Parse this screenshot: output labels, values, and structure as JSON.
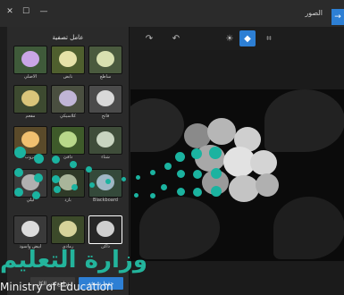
{
  "window": {
    "title": "الصور",
    "controls": {
      "close": "✕",
      "maximize": "☐",
      "minimize": "—"
    },
    "back_icon": "arrow-left-icon"
  },
  "toolbar": {
    "tools": [
      {
        "name": "redo-icon",
        "glyph": "↷"
      },
      {
        "name": "undo-icon",
        "glyph": "↶"
      },
      {
        "name": "adjust-icon",
        "glyph": "☀"
      },
      {
        "name": "filters-icon",
        "glyph": "◆",
        "active": true
      },
      {
        "name": "crop-icon",
        "glyph": "⌗"
      }
    ]
  },
  "filters_panel": {
    "title": "عامل تصفية",
    "items": [
      {
        "label": "الأصلي",
        "selected": false
      },
      {
        "label": "نابض",
        "selected": false
      },
      {
        "label": "ساطع",
        "selected": false
      },
      {
        "label": "مفعم",
        "selected": false
      },
      {
        "label": "كلاسيكي",
        "selected": false
      },
      {
        "label": "فاتح",
        "selected": false
      },
      {
        "label": "غروب",
        "selected": false
      },
      {
        "label": "دافئ",
        "selected": false
      },
      {
        "label": "شتاء",
        "selected": false
      },
      {
        "label": "ليلي",
        "selected": false
      },
      {
        "label": "بارد",
        "selected": false
      },
      {
        "label": "Blackboard",
        "selected": false
      },
      {
        "label": "أبيض وأسود",
        "selected": true
      },
      {
        "label": "رمادي",
        "selected": false
      },
      {
        "label": "داكن",
        "selected": false
      }
    ],
    "save_button": "حفظ نسخة",
    "undo_button": "تراجع عن الكل"
  },
  "watermark": {
    "text": "وزارة التعليم",
    "subtext": "Ministry of Education"
  },
  "colors": {
    "accent": "#2d7fd4",
    "watermark": "#1bb3a0"
  }
}
